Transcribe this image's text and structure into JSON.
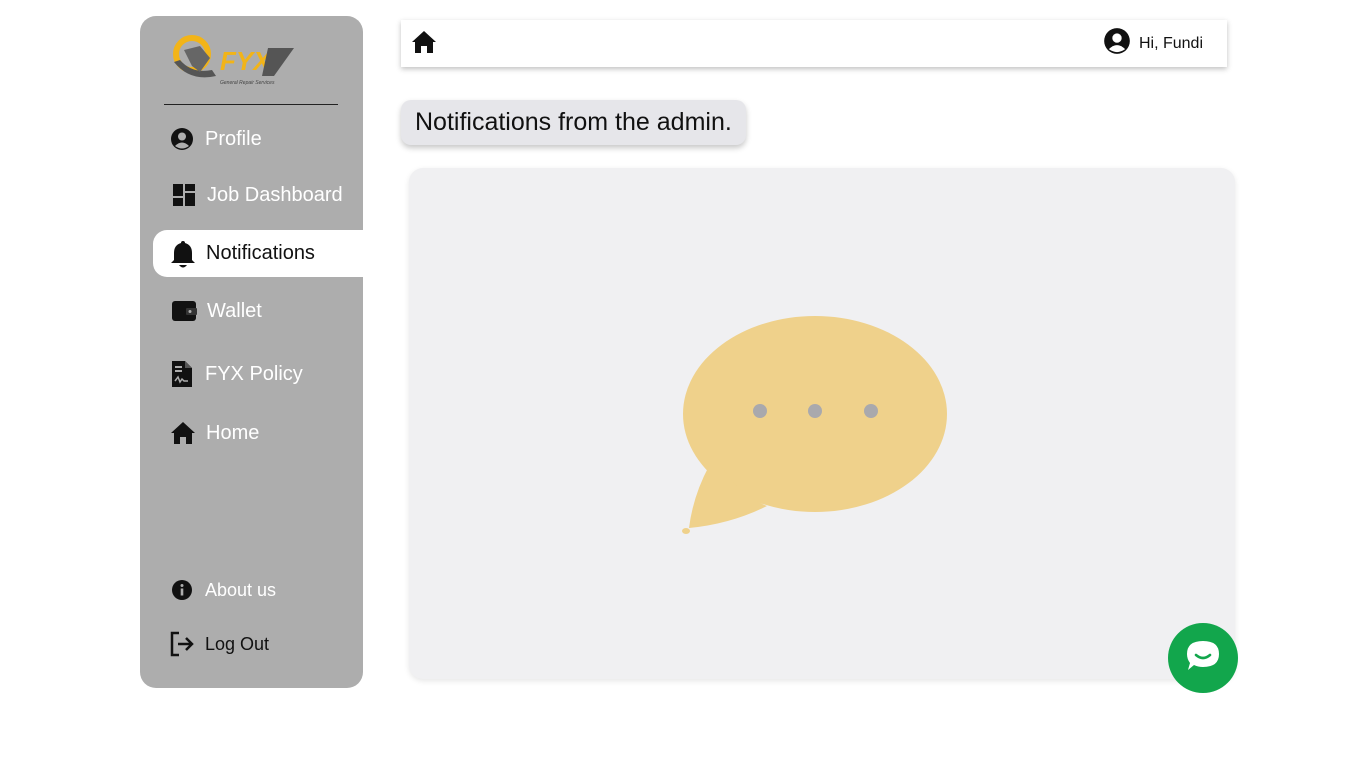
{
  "brand": {
    "logo_text": "FYX",
    "logo_tagline": "General Repair Services",
    "accent_color": "#f2b418"
  },
  "sidebar": {
    "items": [
      {
        "label": "Profile",
        "icon": "user-circle-icon",
        "active": false
      },
      {
        "label": "Job Dashboard",
        "icon": "dashboard-icon",
        "active": false
      },
      {
        "label": "Notifications",
        "icon": "bell-icon",
        "active": true
      },
      {
        "label": "Wallet",
        "icon": "wallet-icon",
        "active": false
      },
      {
        "label": "FYX Policy",
        "icon": "document-icon",
        "active": false
      },
      {
        "label": "Home",
        "icon": "home-icon",
        "active": false
      }
    ],
    "bottom_items": [
      {
        "label": "About us",
        "icon": "info-icon"
      },
      {
        "label": "Log Out",
        "icon": "logout-icon"
      }
    ],
    "background_color": "#adadad"
  },
  "topbar": {
    "home_icon": "home-icon",
    "user_icon": "user-circle-icon",
    "greeting": "Hi, Fundi"
  },
  "main": {
    "heading": "Notifications from the admin.",
    "empty_state_icon": "speech-bubble-icon",
    "bubble_color": "#efd18b"
  },
  "chat_widget": {
    "icon": "chat-icon",
    "color": "#12a64c"
  }
}
